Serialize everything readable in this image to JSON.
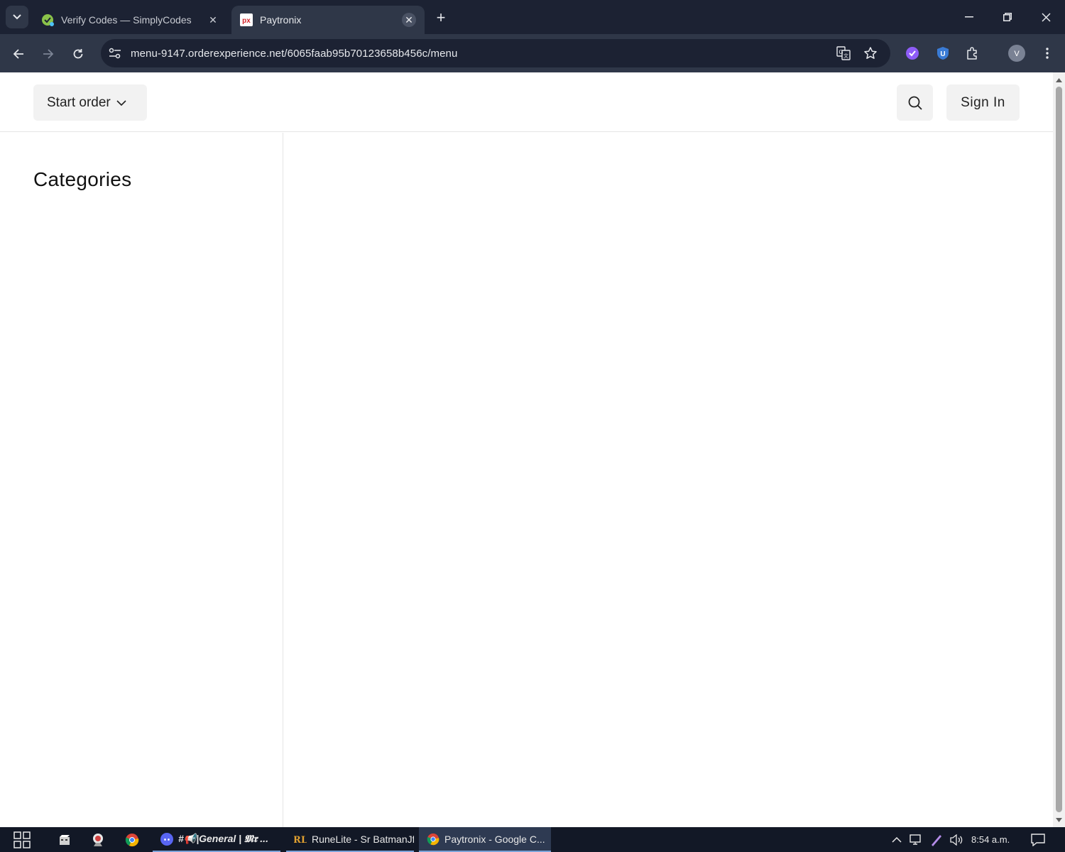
{
  "browser": {
    "tabs": [
      {
        "title": "Verify Codes — SimplyCodes",
        "active": false,
        "favicon": "simplycodes-icon"
      },
      {
        "title": "Paytronix",
        "active": true,
        "favicon": "paytronix-icon",
        "favicon_text": "px"
      }
    ],
    "address_bar": {
      "url": "menu-9147.orderexperience.net/6065faab95b70123658b456c/menu"
    },
    "profile_initial": "V",
    "colors": {
      "frame": "#1c2233",
      "toolbar": "#2f3748"
    }
  },
  "page": {
    "header": {
      "start_order_label": "Start order",
      "sign_in_label": "Sign In"
    },
    "sidebar": {
      "heading": "Categories"
    }
  },
  "taskbar": {
    "apps": [
      {
        "label": "#📢|General | 𝕸𝖗 ...",
        "icon": "discord-icon"
      },
      {
        "label": "RuneLite - Sr BatmanJf",
        "icon": "runelite-icon"
      },
      {
        "label": "Paytronix - Google C...",
        "icon": "chrome-icon"
      }
    ],
    "clock": "8:54 a.m."
  }
}
